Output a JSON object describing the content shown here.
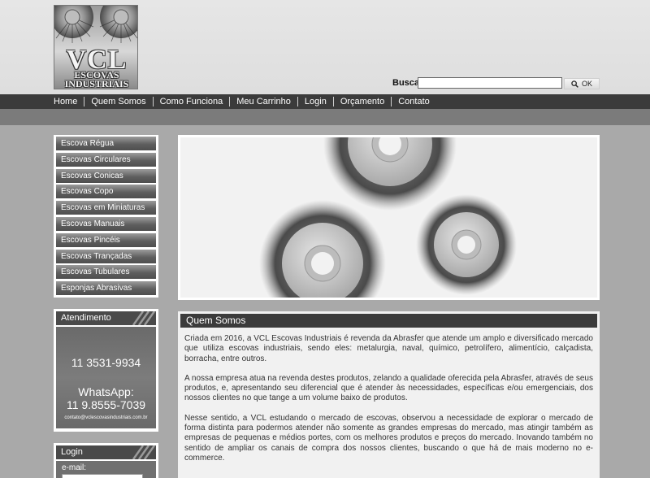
{
  "header": {
    "logo": {
      "main": "VCL",
      "line1": "ESCOVAS",
      "line2": "INDUSTRIAIS"
    },
    "search": {
      "label": "Busca:",
      "value": "",
      "button_label": "OK",
      "button_icon": "search-icon"
    }
  },
  "nav": {
    "items": [
      "Home",
      "Quem Somos",
      "Como Funciona",
      "Meu Carrinho",
      "Login",
      "Orçamento",
      "Contato"
    ]
  },
  "menu": {
    "items": [
      "Escova Régua",
      "Escovas Circulares",
      "Escovas Conicas",
      "Escovas Copo",
      "Escovas em Miniaturas",
      "Escovas Manuais",
      "Escovas Pincéis",
      "Escovas Trançadas",
      "Escovas Tubulares",
      "Esponjas Abrasivas"
    ]
  },
  "atendimento": {
    "title": "Atendimento",
    "phone": "11 3531-9934",
    "whatsapp_label": "WhatsApp:",
    "whatsapp_number": "11 9.8555-7039",
    "email": "contato@vclescovasindustriais.com.br"
  },
  "login": {
    "title": "Login",
    "email_label": "e-mail:"
  },
  "content": {
    "title": "Quem Somos",
    "paragraphs": [
      "Criada em 2016, a VCL Escovas Industriais é revenda da Abrasfer que atende um amplo e diversificado mercado que utiliza escovas industriais, sendo eles: metalurgia, naval, químico, petrolífero, alimentício, calçadista, borracha, entre outros.",
      "A nossa empresa atua na revenda destes produtos, zelando a qualidade oferecida pela Abrasfer, através de seus produtos, e, apresentando seu diferencial que é atender às necessidades, específicas e/ou emergenciais, dos nossos clientes no que tange a um volume baixo de produtos.",
      "Nesse sentido, a VCL estudando o mercado de escovas, observou a necessidade de explorar o mercado de forma distinta para podermos atender não somente as grandes empresas do mercado, mas atingir também as empresas de pequenas e médios portes, com os melhores produtos e preços do mercado. Inovando também no sentido de ampliar os canais de compra dos nossos clientes, buscando o que há de mais moderno no e-commerce."
    ]
  },
  "colors": {
    "page_bg": "#a9a9a9",
    "header_bg": "#e2e2e2",
    "nav_bg": "#3b3b3b",
    "subbar_bg": "#7b7b7b",
    "box_head_bg": "#4a4a4a"
  }
}
